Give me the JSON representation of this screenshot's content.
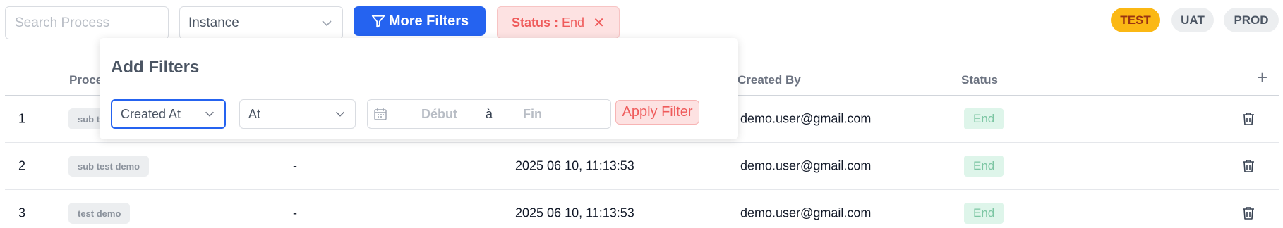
{
  "toolbar": {
    "search_placeholder": "Search Process",
    "instance_value": "Instance",
    "more_filters_label": "More Filters",
    "active_filter": {
      "key": "Status :",
      "value": "End",
      "remove_icon": "✕"
    }
  },
  "environments": [
    "TEST",
    "UAT",
    "PROD"
  ],
  "active_environment": "TEST",
  "table": {
    "columns": [
      "Proce",
      "Created By",
      "Status"
    ],
    "add_column_icon": "+",
    "rows": [
      {
        "index": "1",
        "process": "sub t",
        "version": "",
        "created_at": "",
        "created_by": "demo.user@gmail.com",
        "status": "End"
      },
      {
        "index": "2",
        "process": "sub test demo",
        "version": "-",
        "created_at": "2025 06 10, 11:13:53",
        "created_by": "demo.user@gmail.com",
        "status": "End"
      },
      {
        "index": "3",
        "process": "test demo",
        "version": "-",
        "created_at": "2025 06 10, 11:13:53",
        "created_by": "demo.user@gmail.com",
        "status": "End"
      }
    ]
  },
  "add_filters": {
    "title": "Add Filters",
    "field_value": "Created At",
    "operator_value": "At",
    "start_placeholder": "Début",
    "separator": "à",
    "end_placeholder": "Fin",
    "apply_label": "Apply Filter"
  },
  "colors": {
    "primary": "#2563f0",
    "danger_bg": "#fde2e2",
    "danger_text": "#ef5b5b",
    "test_badge": "#fbb814",
    "status_bg": "#def5ea",
    "status_text": "#7cc6a3"
  }
}
